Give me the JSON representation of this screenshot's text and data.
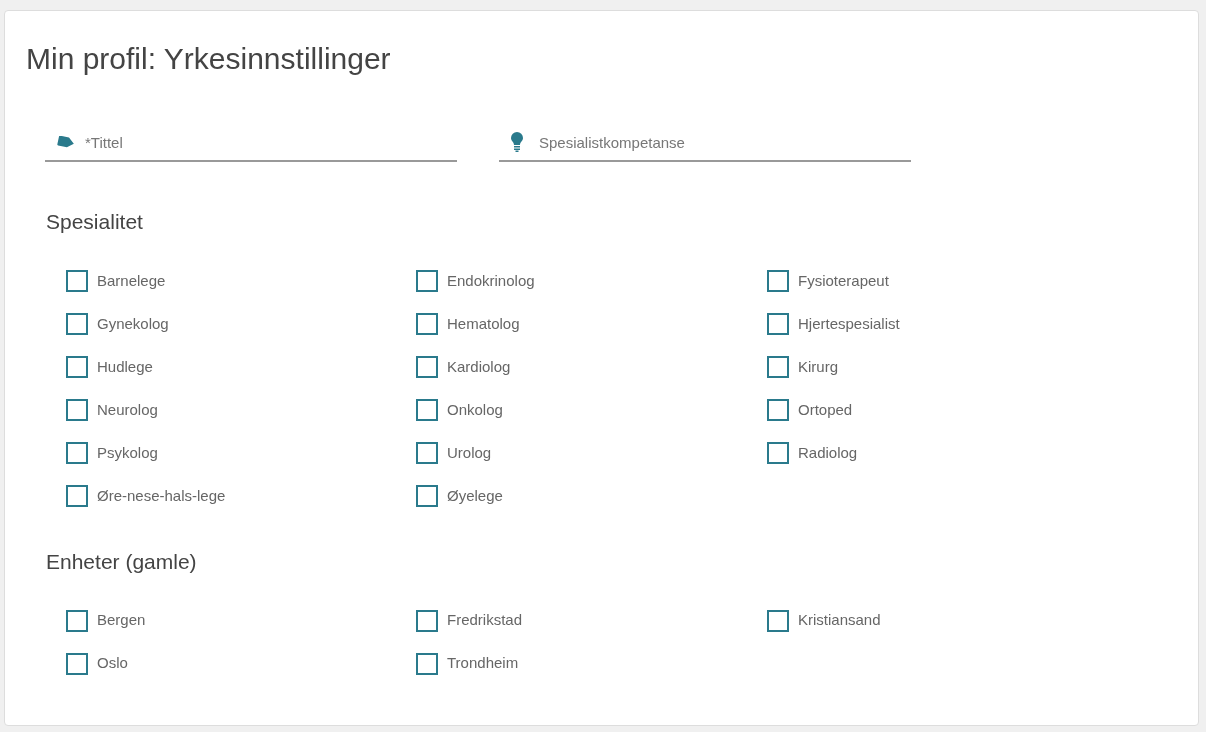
{
  "page": {
    "title": "Min profil: Yrkesinnstillinger"
  },
  "fields": [
    {
      "kind": "tag",
      "placeholder": "*Tittel"
    },
    {
      "kind": "bulb",
      "placeholder": "Spesialistkompetanse"
    }
  ],
  "sections": [
    {
      "heading": "Spesialitet",
      "options": [
        {
          "label": "Barnelege",
          "checked": false
        },
        {
          "label": "Endokrinolog",
          "checked": false
        },
        {
          "label": "Fysioterapeut",
          "checked": false
        },
        {
          "label": "Gynekolog",
          "checked": false
        },
        {
          "label": "Hematolog",
          "checked": false
        },
        {
          "label": "Hjertespesialist",
          "checked": false
        },
        {
          "label": "Hudlege",
          "checked": false
        },
        {
          "label": "Kardiolog",
          "checked": false
        },
        {
          "label": "Kirurg",
          "checked": false
        },
        {
          "label": "Neurolog",
          "checked": false
        },
        {
          "label": "Onkolog",
          "checked": false
        },
        {
          "label": "Ortoped",
          "checked": false
        },
        {
          "label": "Psykolog",
          "checked": false
        },
        {
          "label": "Urolog",
          "checked": false
        },
        {
          "label": "Radiolog",
          "checked": false
        },
        {
          "label": "Øre-nese-hals-lege",
          "checked": false
        },
        {
          "label": "Øyelege",
          "checked": false
        }
      ]
    },
    {
      "heading": "Enheter (gamle)",
      "options": [
        {
          "label": "Bergen",
          "checked": false
        },
        {
          "label": "Fredrikstad",
          "checked": false
        },
        {
          "label": "Kristiansand",
          "checked": false
        },
        {
          "label": "Oslo",
          "checked": false
        },
        {
          "label": "Trondheim",
          "checked": false
        }
      ]
    }
  ]
}
